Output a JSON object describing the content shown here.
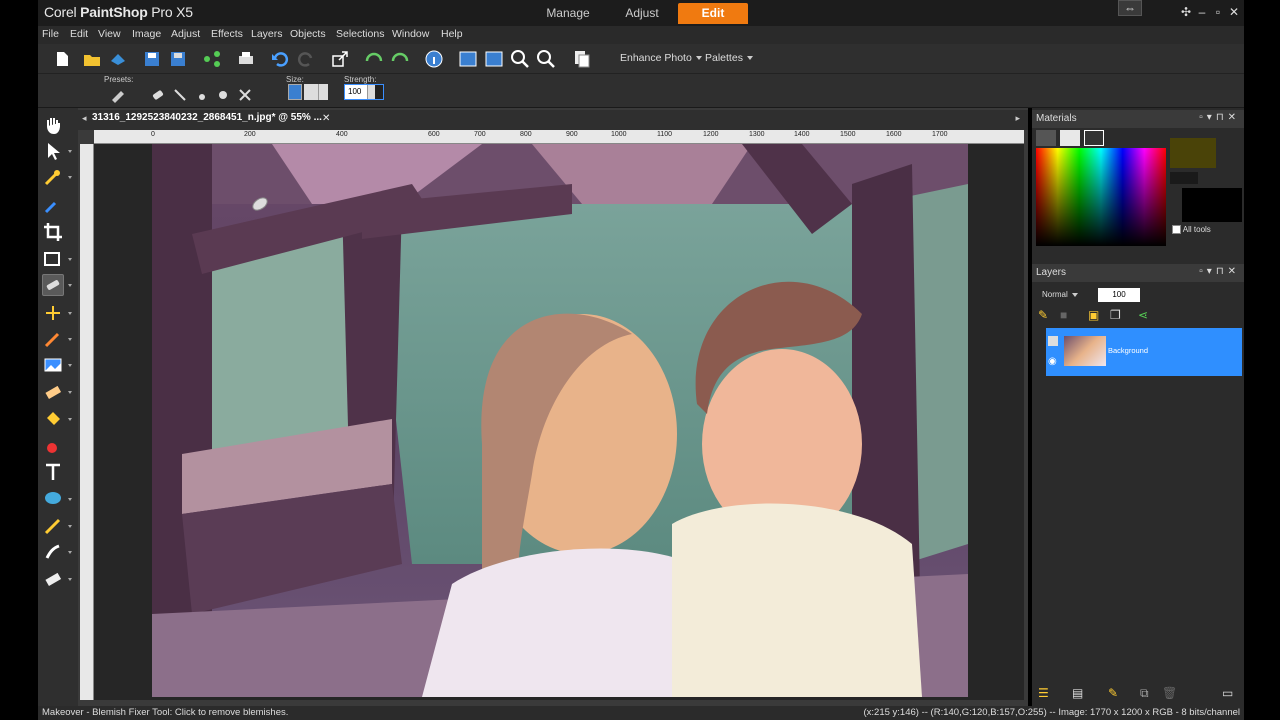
{
  "app": {
    "title_brand": "Corel",
    "title_product": "PaintShop",
    "title_version": "Pro X5"
  },
  "modes": [
    {
      "label": "Manage"
    },
    {
      "label": "Adjust"
    },
    {
      "label": "Edit"
    }
  ],
  "menubar": [
    "File",
    "Edit",
    "View",
    "Image",
    "Adjust",
    "Effects",
    "Layers",
    "Objects",
    "Selections",
    "Window",
    "Help"
  ],
  "toolbar": {
    "enhance_photo": "Enhance Photo",
    "palettes": "Palettes"
  },
  "tool_options": {
    "presets_label": "Presets:",
    "size_label": "Size:",
    "size_value": "",
    "strength_label": "Strength:",
    "strength_value": "100"
  },
  "document": {
    "tab_title": "31316_1292523840232_2868451_n.jpg* @  55% ...",
    "ruler_top": [
      "0",
      "200",
      "400",
      "600",
      "700",
      "800",
      "900",
      "1000",
      "1100",
      "1200",
      "1300",
      "1400",
      "1500",
      "1600",
      "1700"
    ]
  },
  "materials": {
    "title": "Materials",
    "all_tools_label": "All tools",
    "foreground_color": "#4a4308"
  },
  "layers": {
    "title": "Layers",
    "blend_mode": "Normal",
    "opacity": "100",
    "layer_name": "Background"
  },
  "status": {
    "left": "Makeover - Blemish Fixer Tool: Click to remove blemishes.",
    "right": "(x:215 y:146) -- (R:140,G:120,B:157,O:255) -- Image:  1770 x 1200 x RGB - 8 bits/channel"
  },
  "colors": {
    "accent": "#f07a10",
    "selection": "#2f8fff"
  }
}
